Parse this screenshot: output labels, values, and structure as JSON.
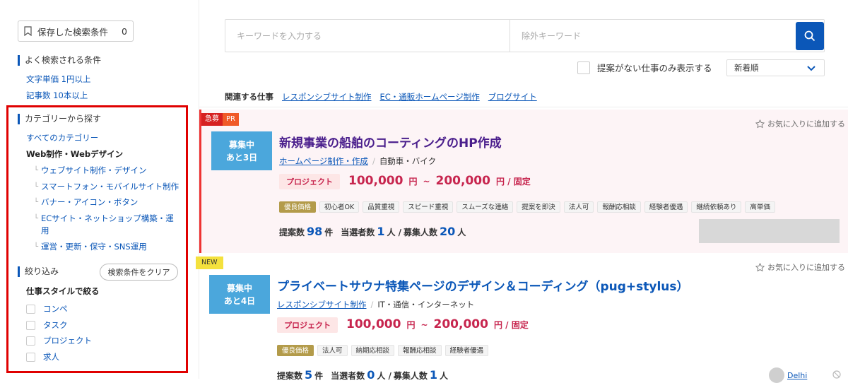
{
  "sidebar": {
    "saved_search_label": "保存した検索条件",
    "saved_search_count": "0",
    "popular_title": "よく検索される条件",
    "popular_links": [
      "文字単価 1円以上",
      "記事数 10本以上"
    ],
    "category_title": "カテゴリーから探す",
    "all_categories": "すべてのカテゴリー",
    "current_category": "Web制作・Webデザイン",
    "sub_categories": [
      "ウェブサイト制作・デザイン",
      "スマートフォン・モバイルサイト制作",
      "バナー・アイコン・ボタン",
      "ECサイト・ネットショップ構築・運用",
      "運営・更新・保守・SNS運用"
    ],
    "filter_title": "絞り込み",
    "clear_button": "検索条件をクリア",
    "work_style_title": "仕事スタイルで絞る",
    "work_styles": [
      "コンペ",
      "タスク",
      "プロジェクト",
      "求人"
    ]
  },
  "search": {
    "keyword_placeholder": "キーワードを入力する",
    "exclude_placeholder": "除外キーワード"
  },
  "filters": {
    "no_proposal_label": "提案がない仕事のみ表示する",
    "sort_value": "新着順"
  },
  "related": {
    "label": "関連する仕事",
    "links": [
      "レスポンシブサイト制作",
      "EC・通販ホームページ制作",
      "ブログサイト"
    ]
  },
  "jobs": [
    {
      "tags": [
        "急募",
        "PR"
      ],
      "status_line1": "募集中",
      "status_line2": "あと3日",
      "title": "新規事業の船舶のコーティングのHP作成",
      "category": "ホームページ制作・作成",
      "subcategory": "自動車・バイク",
      "price_type": "プロジェクト",
      "price_min": "100,000",
      "price_max": "200,000",
      "yen": "円",
      "tilde": "~",
      "price_unit": "円 / 固定",
      "features": [
        "優良価格",
        "初心者OK",
        "品質重視",
        "スピード重視",
        "スムーズな連絡",
        "提案を即決",
        "法人可",
        "報酬応相談",
        "経験者優遇",
        "継続依頼あり",
        "高単価"
      ],
      "proposals_label": "提案数",
      "proposals": "98",
      "proposals_unit": "件",
      "winners_label": "当選者数",
      "winners": "1",
      "winners_unit": "人 /",
      "recruit_label": "募集人数",
      "recruit": "20",
      "recruit_unit": "人",
      "favorite": "お気に入りに追加する"
    },
    {
      "badge": "NEW",
      "status_line1": "募集中",
      "status_line2": "あと4日",
      "title": "プライベートサウナ特集ページのデザイン＆コーディング（pug+stylus）",
      "category": "レスポンシブサイト制作",
      "subcategory": "IT・通信・インターネット",
      "price_type": "プロジェクト",
      "price_min": "100,000",
      "price_max": "200,000",
      "yen": "円",
      "tilde": "~",
      "price_unit": "円 / 固定",
      "features": [
        "優良価格",
        "法人可",
        "納期応相談",
        "報酬応相談",
        "経験者優遇"
      ],
      "proposals_label": "提案数",
      "proposals": "5",
      "proposals_unit": "件",
      "winners_label": "当選者数",
      "winners": "0",
      "winners_unit": "人 /",
      "recruit_label": "募集人数",
      "recruit": "1",
      "recruit_unit": "人",
      "favorite": "お気に入りに追加する",
      "client_name": "Delhi"
    }
  ]
}
